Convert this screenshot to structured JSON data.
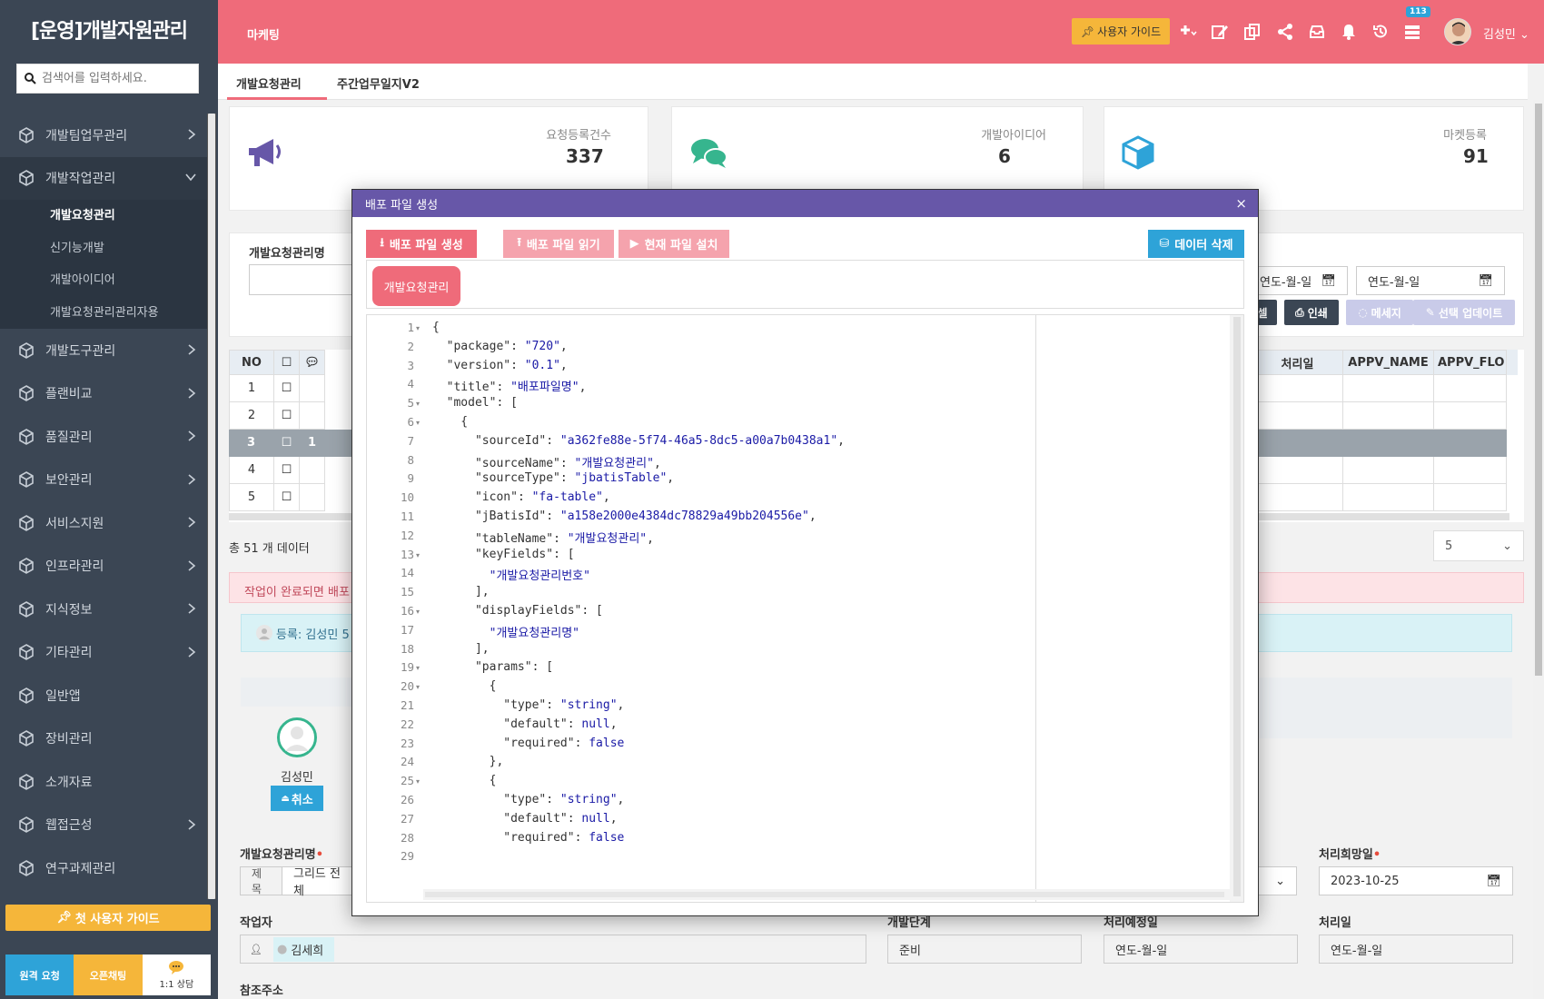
{
  "sidebar": {
    "brand": "[운영]개발자원관리",
    "search_placeholder": "검색어를 입력하세요.",
    "menu": [
      {
        "label": "개발팀업무관리"
      },
      {
        "label": "개발작업관리"
      },
      {
        "label": "개발도구관리"
      },
      {
        "label": "플랜비교"
      },
      {
        "label": "품질관리"
      },
      {
        "label": "보안관리"
      },
      {
        "label": "서비스지원"
      },
      {
        "label": "인프라관리"
      },
      {
        "label": "지식정보"
      },
      {
        "label": "기타관리"
      },
      {
        "label": "일반앱"
      },
      {
        "label": "장비관리"
      },
      {
        "label": "소개자료"
      },
      {
        "label": "웹접근성"
      },
      {
        "label": "연구과제관리"
      }
    ],
    "submenu": [
      {
        "label": "개발요청관리"
      },
      {
        "label": "신기능개발"
      },
      {
        "label": "개발아이디어"
      },
      {
        "label": "개발요청관리관리자용"
      }
    ],
    "guide_button": "첫 사용자 가이드",
    "bottom": {
      "remote": "원격 요청",
      "openchat": "오픈채팅",
      "consult": "1:1 상담"
    }
  },
  "header": {
    "breadcrumb": "마케팅",
    "guide_button": "사용자 가이드",
    "badge_count": "113",
    "user_name": "김성민"
  },
  "tabs": [
    {
      "label": "개발요청관리"
    },
    {
      "label": "주간업무일지V2"
    }
  ],
  "stats": [
    {
      "label": "요청등록건수",
      "value": "337"
    },
    {
      "label": "개발아이디어",
      "value": "6"
    },
    {
      "label": "마켓등록",
      "value": "91"
    }
  ],
  "filter": {
    "name_label": "개발요청관리명",
    "date_from": "연도-월-일",
    "date_to": "연도-월-일",
    "excel_button": "셀",
    "print_button": "인쇄",
    "message_button": "메세지",
    "bulk_update_button": "선택 업데이트"
  },
  "grid": {
    "columns_left": [
      "NO"
    ],
    "columns_right": [
      "처리일",
      "APPV_NAME",
      "APPV_FLO"
    ],
    "rows": [
      {
        "no": "1",
        "comments": ""
      },
      {
        "no": "2",
        "comments": ""
      },
      {
        "no": "3",
        "comments": "1"
      },
      {
        "no": "4",
        "comments": ""
      },
      {
        "no": "5",
        "comments": ""
      }
    ],
    "total_text": "총 51 개 데이터",
    "page_size": "5"
  },
  "alert_text": "작업이 완료되면 배포",
  "info_text": "등록: 김성민 5",
  "detail": {
    "person_name": "김성민",
    "cancel_button": "취소",
    "name_label": "개발요청관리명",
    "title_prefix": "제목",
    "title_value": "그리드 전체",
    "hope_date_label": "처리희망일",
    "hope_date_value": "2023-10-25",
    "worker_label": "작업자",
    "worker_value": "김세희",
    "stage_label": "개발단계",
    "stage_value": "준비",
    "plan_date_label": "처리예정일",
    "plan_date_value": "연도-월-일",
    "done_date_label": "처리일",
    "done_date_value": "연도-월-일",
    "ref_label": "참조주소"
  },
  "modal": {
    "title": "배포 파일 생성",
    "btn_create": "배포 파일 생성",
    "btn_read": "배포 파일 읽기",
    "btn_install": "현재 파일 설치",
    "btn_delete": "데이터 삭제",
    "tab_label": "개발요청관리",
    "code_lines": [
      "{",
      "  \"package\": \"720\",",
      "  \"version\": \"0.1\",",
      "  \"title\": \"배포파일명\",",
      "  \"model\": [",
      "    {",
      "      \"sourceId\": \"a362fe88e-5f74-46a5-8dc5-a00a7b0438a1\",",
      "      \"sourceName\": \"개발요청관리\",",
      "      \"sourceType\": \"jbatisTable\",",
      "      \"icon\": \"fa-table\",",
      "      \"jBatisId\": \"a158e2000e4384dc78829a49bb204556e\",",
      "      \"tableName\": \"개발요청관리\",",
      "      \"keyFields\": [",
      "        \"개발요청관리번호\"",
      "      ],",
      "      \"displayFields\": [",
      "        \"개발요청관리명\"",
      "      ],",
      "      \"params\": [",
      "        {",
      "          \"type\": \"string\",",
      "          \"default\": null,",
      "          \"required\": false",
      "        },",
      "        {",
      "          \"type\": \"string\",",
      "          \"default\": null,",
      "          \"required\": false",
      "        "
    ],
    "line_numbers": [
      "1",
      "2",
      "3",
      "4",
      "5",
      "6",
      "7",
      "8",
      "9",
      "10",
      "11",
      "12",
      "13",
      "14",
      "15",
      "16",
      "17",
      "18",
      "19",
      "20",
      "21",
      "22",
      "23",
      "24",
      "25",
      "26",
      "27",
      "28",
      "29"
    ],
    "fold_lines": [
      1,
      5,
      6,
      13,
      16,
      19,
      20,
      25
    ]
  },
  "colors": {
    "header": "#ef6b7a",
    "sidebar": "#3b4654",
    "modal_header": "#6757a8",
    "accent_blue": "#2ea3d8",
    "accent_yellow": "#f5b63a"
  }
}
